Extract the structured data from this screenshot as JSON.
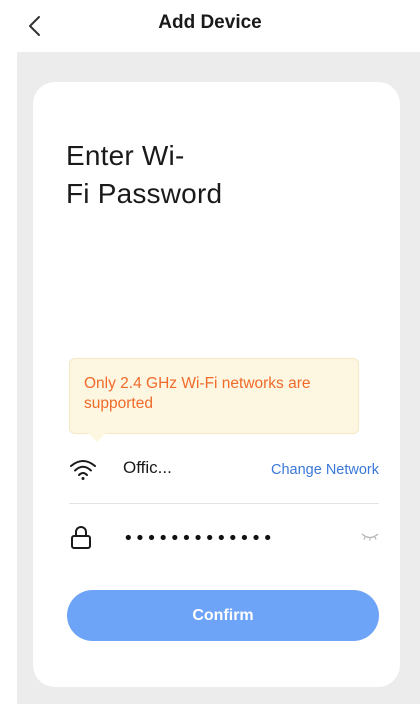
{
  "header": {
    "back_icon": "chevron-left-icon",
    "title": "Add Device"
  },
  "card": {
    "heading": "Enter Wi-\nFi Password",
    "tooltip": "Only 2.4 GHz Wi-Fi networks are supported",
    "network": {
      "icon": "wifi-icon",
      "name": "Offic...",
      "change_label": "Change Network"
    },
    "password": {
      "icon": "lock-icon",
      "value": "•••••••••••••",
      "visibility_icon": "eye-closed-icon"
    },
    "confirm_label": "Confirm"
  },
  "colors": {
    "accent": "#6ea4f7",
    "link": "#3a78d9",
    "warning_text": "#f06a2a",
    "warning_bg": "#fdf7e1",
    "page_bg": "#ececec"
  }
}
